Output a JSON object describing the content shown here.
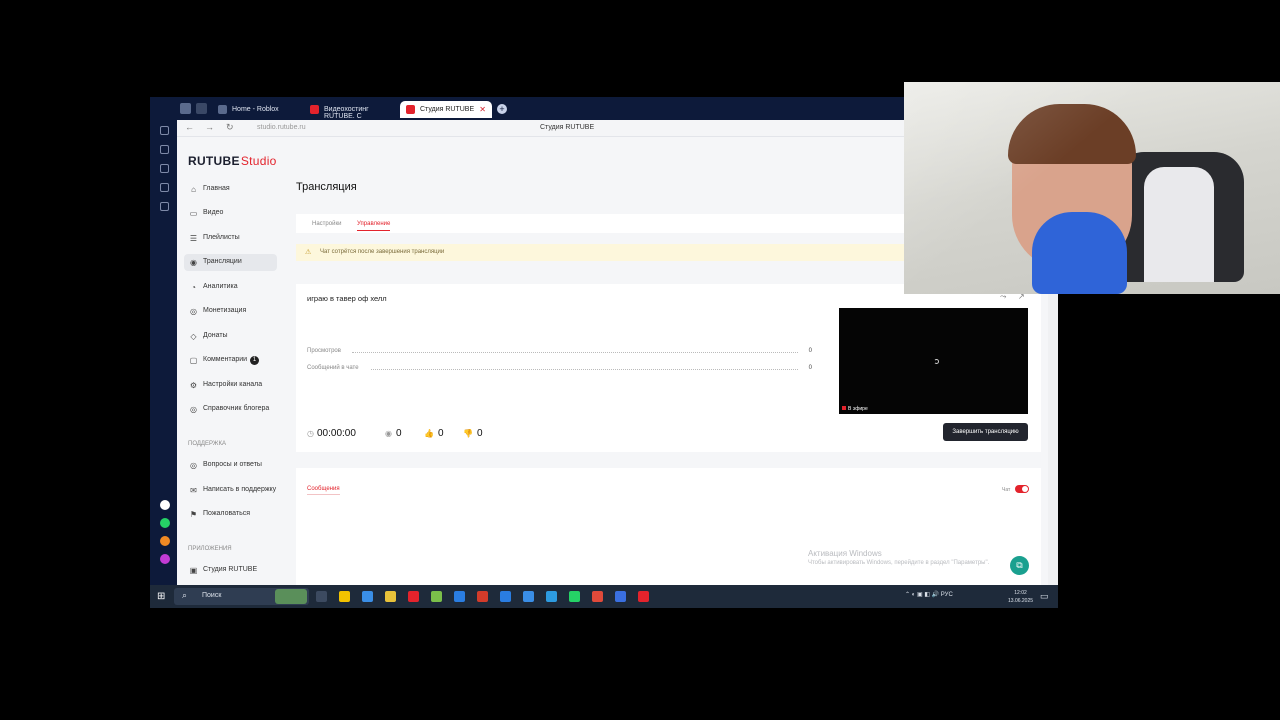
{
  "browser": {
    "tabs": [
      {
        "label": "Home - Roblox",
        "favicon_color": "#5a6a8c"
      },
      {
        "label": "Видеохостинг RUTUBE. С",
        "favicon_color": "#e3232c"
      },
      {
        "label": "Студия RUTUBE",
        "favicon_color": "#e3232c",
        "close": "✕"
      }
    ],
    "new_tab": "+",
    "nav": {
      "back": "←",
      "forward": "→",
      "reload": "↻"
    },
    "url": "studio.rutube.ru",
    "page_title": "Студия RUTUBE",
    "bookmark": "🔖"
  },
  "logo": {
    "brand": "RUTUBE",
    "suffix": "Studio"
  },
  "sidebar": {
    "items": [
      {
        "label": "Главная",
        "icon": "home-icon",
        "glyph": "⌂"
      },
      {
        "label": "Видео",
        "icon": "video-icon",
        "glyph": "▭"
      },
      {
        "label": "Плейлисты",
        "icon": "playlist-icon",
        "glyph": "☰"
      },
      {
        "label": "Трансляции",
        "icon": "broadcast-icon",
        "glyph": "◉"
      },
      {
        "label": "Аналитика",
        "icon": "analytics-icon",
        "glyph": "◔"
      },
      {
        "label": "Монетизация",
        "icon": "monetization-icon",
        "glyph": "◎"
      },
      {
        "label": "Донаты",
        "icon": "donations-icon",
        "glyph": "◇"
      },
      {
        "label": "Комментарии",
        "icon": "comments-icon",
        "glyph": "▢",
        "badge": "1"
      },
      {
        "label": "Настройки канала",
        "icon": "settings-icon",
        "glyph": "⚙"
      },
      {
        "label": "Справочник блогера",
        "icon": "guide-icon",
        "glyph": "◎"
      }
    ],
    "support_section": "Поддержка",
    "support_items": [
      {
        "label": "Вопросы и ответы",
        "icon": "faq-icon",
        "glyph": "◎"
      },
      {
        "label": "Написать в поддержку",
        "icon": "mail-icon",
        "glyph": "✉"
      },
      {
        "label": "Пожаловаться",
        "icon": "flag-icon",
        "glyph": "⚑"
      }
    ],
    "apps_section": "Приложения",
    "apps_items": [
      {
        "label": "Студия RUTUBE",
        "icon": "app-icon",
        "glyph": "▣"
      }
    ]
  },
  "main": {
    "title": "Трансляция",
    "tabs": [
      {
        "label": "Настройки"
      },
      {
        "label": "Управление"
      }
    ],
    "notice": "Чат сотрётся после завершения трансляции",
    "stream": {
      "title": "играю в тавер оф хелл",
      "stats": [
        {
          "label": "Просмотров",
          "value": "0"
        },
        {
          "label": "Сообщений в чате",
          "value": "0"
        }
      ],
      "timer": "00:00:00",
      "metrics": [
        {
          "icon": "viewers-icon",
          "glyph": "◉",
          "value": "0"
        },
        {
          "icon": "like-icon",
          "glyph": "👍",
          "value": "0"
        },
        {
          "icon": "dislike-icon",
          "glyph": "👎",
          "value": "0"
        }
      ],
      "live_label": "В эфире",
      "end_button": "Завершить трансляцию",
      "share": "⤳",
      "open": "↗"
    },
    "messages": {
      "title": "Сообщения",
      "chat_label": "Чат"
    },
    "activation": {
      "line1": "Активация Windows",
      "line2": "Чтобы активировать Windows, перейдите в раздел \"Параметры\"."
    },
    "fab": "⧉"
  },
  "taskbar": {
    "start": "⊞",
    "search_placeholder": "Поиск",
    "search_icon": "⌕",
    "apps": [
      "#f2c200",
      "#3a8ee6",
      "#e8c23a",
      "#e3232c",
      "#7bbf4a",
      "#2a7de1",
      "#d23b2a",
      "#2a7de1",
      "#2d9be0",
      "#25d366",
      "#e04a3a",
      "#3a6fe0",
      "#e3232c"
    ],
    "tray": "⌃ ◐ ▣ ◧ 🔊 РУС",
    "time": "12:02",
    "date": "13.06.2025",
    "notifications": "▭"
  }
}
